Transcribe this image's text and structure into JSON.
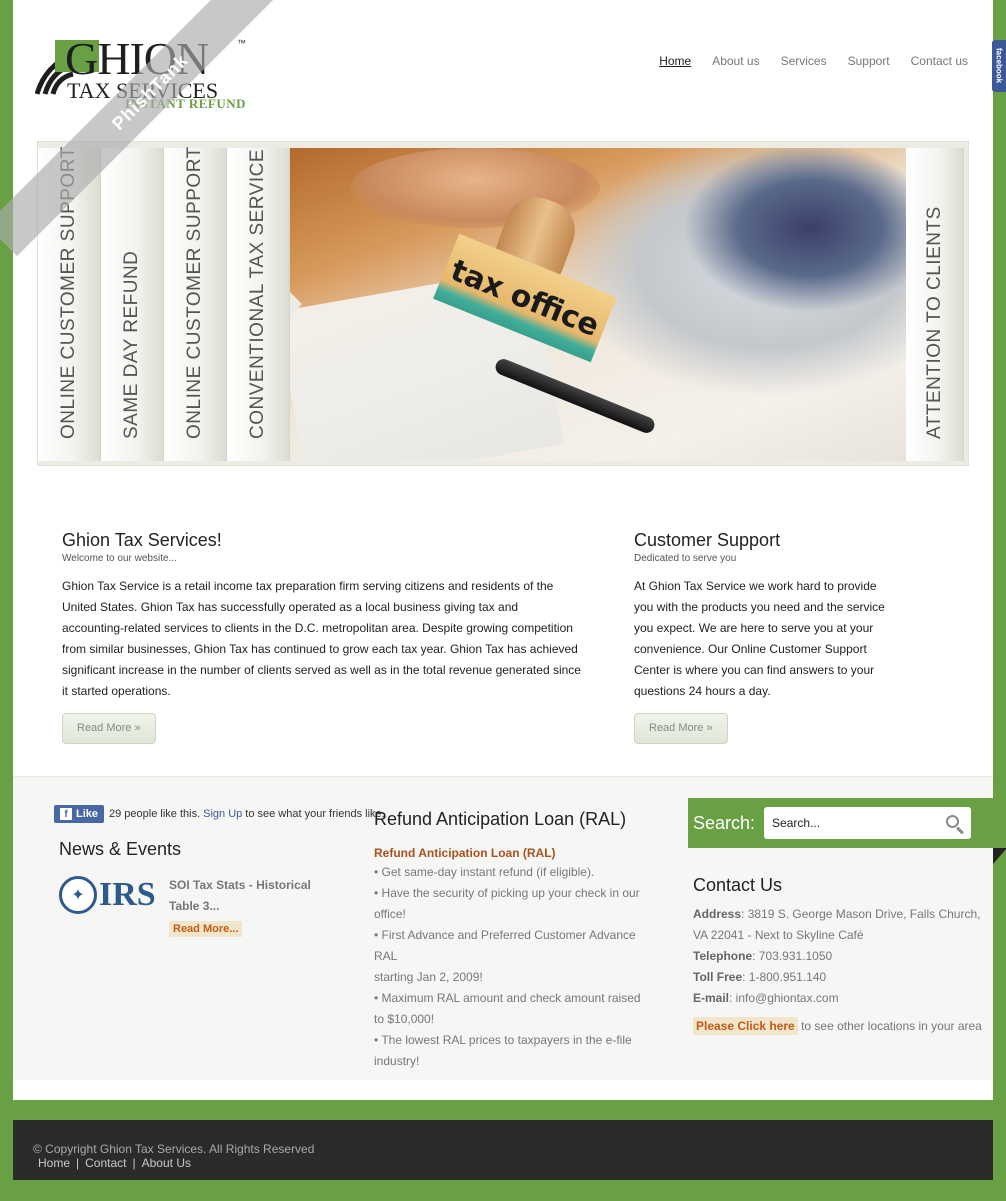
{
  "brand": {
    "name": "GHION",
    "sub": "TAX SERVICES",
    "tagline": "INSTANT REFUND",
    "tm": "™"
  },
  "nav": {
    "items": [
      "Home",
      "About us",
      "Services",
      "Support",
      "Contact us"
    ]
  },
  "facebook_tab": "facebook",
  "slider": {
    "tabs": [
      "ONLINE CUSTOMER SUPPORT",
      "SAME DAY REFUND",
      "ONLINE CUSTOMER SUPPORT",
      "CONVENTIONAL TAX SERVICE"
    ],
    "right_tab": "ATTENTION TO CLIENTS",
    "stamp_text": "tax office"
  },
  "intro": {
    "title": "Ghion Tax Services!",
    "tagline": "Welcome to our website...",
    "body": "Ghion Tax Service is a retail income tax preparation firm serving citizens and residents of the United States. Ghion Tax has successfully operated as a local business giving tax and accounting-related services to clients in the D.C. metropolitan area. Despite growing competition from similar businesses, Ghion Tax has continued to grow each tax year. Ghion Tax has achieved significant increase in the number of clients served as well as in the total revenue generated since it started operations.",
    "button": "Read More »"
  },
  "support": {
    "title": "Customer Support",
    "tagline": "Dedicated to serve you",
    "body": "At Ghion Tax Service we work hard to provide you with the products you need and the service you expect. We are here to serve you at your convenience. Our Online Customer Support Center is where you can find answers to your questions 24 hours a day.",
    "button": "Read More »"
  },
  "fb_like": {
    "button": "Like",
    "count_text": "29 people like this.",
    "signup": "Sign Up",
    "suffix": "to see what your friends like."
  },
  "news": {
    "title": "News & Events",
    "logo_text": "IRS",
    "item_title": "SOI Tax Stats - Historical Table 3...",
    "read_more": "Read More..."
  },
  "ral": {
    "title": "Refund Anticipation Loan (RAL)",
    "subtitle": "Refund Anticipation Loan (RAL)",
    "items": [
      "Get same-day instant refund (if eligible).",
      "Have the security of picking up your check in our office!",
      "First Advance and Preferred Customer Advance RAL",
      "starting Jan 2, 2009!",
      "Maximum RAL amount and check amount raised to $10,000!",
      "The lowest RAL prices to taxpayers in the e-file industry!"
    ]
  },
  "search": {
    "label": "Search:",
    "placeholder": "Search..."
  },
  "contact": {
    "title": "Contact Us",
    "address_label": "Address",
    "address": ": 3819 S. George Mason Drive, Falls Church, VA 22041 - Next to Skyline Café",
    "telephone_label": "Telephone",
    "telephone": ": 703.931.1050",
    "tollfree_label": "Toll Free",
    "tollfree": ": 1-800.951.140",
    "email_label": "E-mail",
    "email": ": info@ghiontax.com",
    "click_label": "Please Click here",
    "click_suffix": "to see other locations in your area"
  },
  "footer": {
    "copyright": "© Copyright Ghion Tax Services. All Rights Reserved",
    "links": [
      "Home",
      "Contact",
      "About Us"
    ]
  },
  "watermark": "PhishTank",
  "colors": {
    "green": "#6aa044",
    "dark": "#2b2b2b",
    "orange": "#c75a14"
  }
}
